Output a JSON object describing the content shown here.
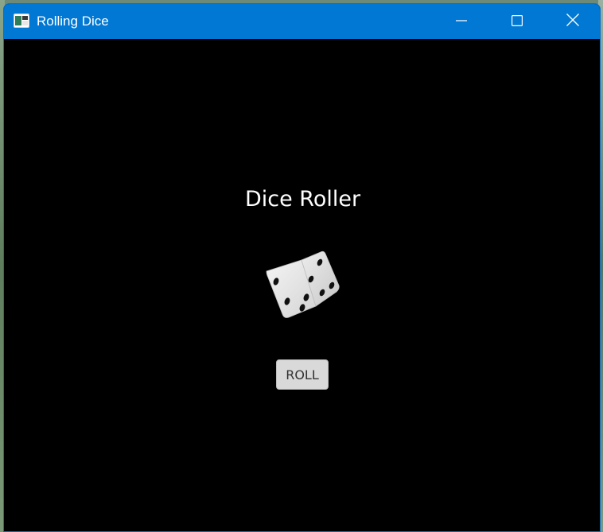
{
  "window": {
    "title": "Rolling Dice",
    "icon": "app-window-icon",
    "controls": {
      "minimize": "minimize-icon",
      "maximize": "maximize-icon",
      "close": "close-icon"
    }
  },
  "main": {
    "heading": "Dice Roller",
    "dice": {
      "icon": "dice-icon",
      "visible_pips_top_face": 3,
      "visible_pips_front_face": 4
    },
    "roll_button_label": "ROLL"
  },
  "colors": {
    "titlebar": "#0078d4",
    "content_background": "#000000",
    "heading_text": "#ffffff",
    "button_background": "#d9d9d9",
    "button_text": "#333333"
  }
}
